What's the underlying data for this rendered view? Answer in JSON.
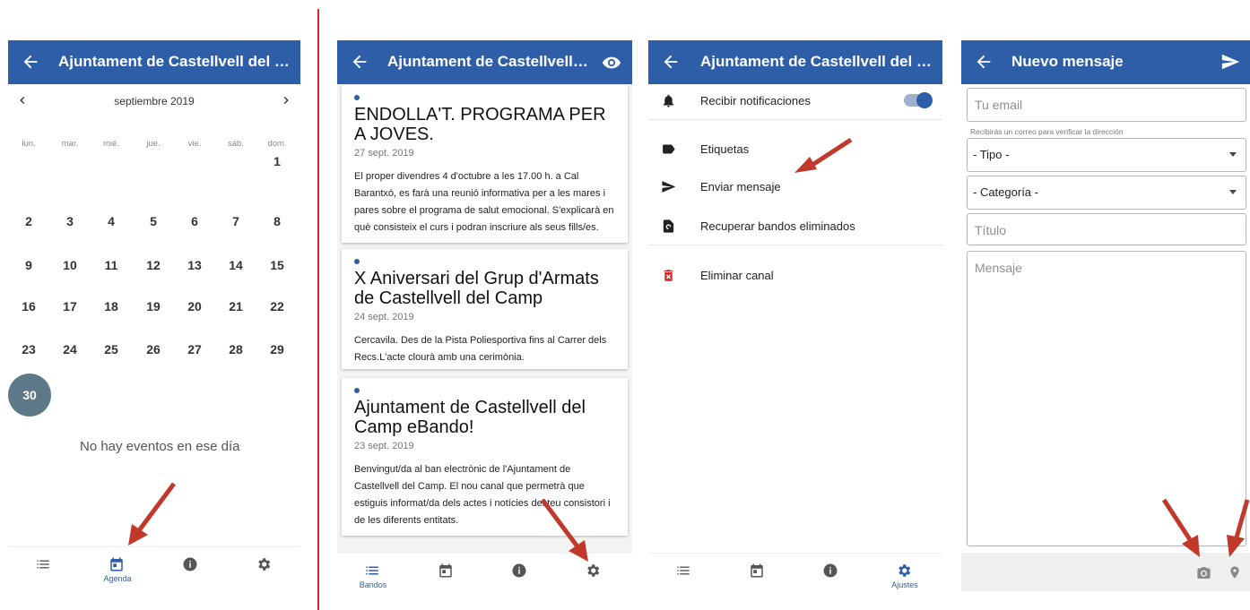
{
  "screen1": {
    "title": "Ajuntament de Castellvell del Camp",
    "month": "septiembre 2019",
    "weekdays": [
      "lun.",
      "mar.",
      "mié.",
      "jue.",
      "vie.",
      "sáb.",
      "dom."
    ],
    "weeks": [
      [
        "",
        "",
        "",
        "",
        "",
        "",
        "1"
      ],
      [
        "2",
        "3",
        "4",
        "5",
        "6",
        "7",
        "8"
      ],
      [
        "9",
        "10",
        "11",
        "12",
        "13",
        "14",
        "15"
      ],
      [
        "16",
        "17",
        "18",
        "19",
        "20",
        "21",
        "22"
      ],
      [
        "23",
        "24",
        "25",
        "26",
        "27",
        "28",
        "29"
      ]
    ],
    "selected_day": "30",
    "no_events": "No hay eventos en ese día",
    "nav_agenda_label": "Agenda"
  },
  "screen2": {
    "title": "Ajuntament de Castellvell de...",
    "cards": [
      {
        "title": "ENDOLLA'T. PROGRAMA PER A JOVES.",
        "date": "27 sept. 2019",
        "body": "El proper divendres 4 d'octubre a les 17.00 h. a Cal Barantxó, es farà una reunió informativa per a les mares i pares sobre el programa de salut emocional. S'explicarà en què consisteix el curs i podran inscriure als seus fills/es."
      },
      {
        "title": "X Aniversari del Grup d'Armats de Castellvell del Camp",
        "date": "24 sept. 2019",
        "body": "Cercavila. Des de la Pista Poliesportiva fins al Carrer dels Recs.L'acte clourà amb una cerimònia."
      },
      {
        "title": "Ajuntament de Castellvell del Camp eBando!",
        "date": "23 sept. 2019",
        "body": "Benvingut/da al ban electrònic de l'Ajuntament de Castellvell del Camp. El nou canal que permetrà que estiguis informat/da dels actes i notícies del teu consistori i de les diferents entitats."
      }
    ],
    "nav_bandos_label": "Bandos"
  },
  "screen3": {
    "title": "Ajuntament de Castellvell del Camp",
    "rows": {
      "notifications": "Recibir notificaciones",
      "labels": "Etiquetas",
      "send_message": "Enviar mensaje",
      "recover": "Recuperar bandos eliminados",
      "delete_channel": "Eliminar canal"
    },
    "toggle_on": true,
    "nav_ajustes_label": "Ajustes"
  },
  "screen4": {
    "title": "Nuevo mensaje",
    "email_placeholder": "Tu email",
    "email_hint": "Recibirás un correo para verificar la dirección",
    "tipo": "- Tipo -",
    "categoria": "- Categoría -",
    "titulo_placeholder": "Título",
    "mensaje_placeholder": "Mensaje"
  },
  "colors": {
    "appbar": "#2f5ea8",
    "selected_day": "#5d7988",
    "annotation_arrow": "#c0392b",
    "divider": "#d5262e"
  }
}
